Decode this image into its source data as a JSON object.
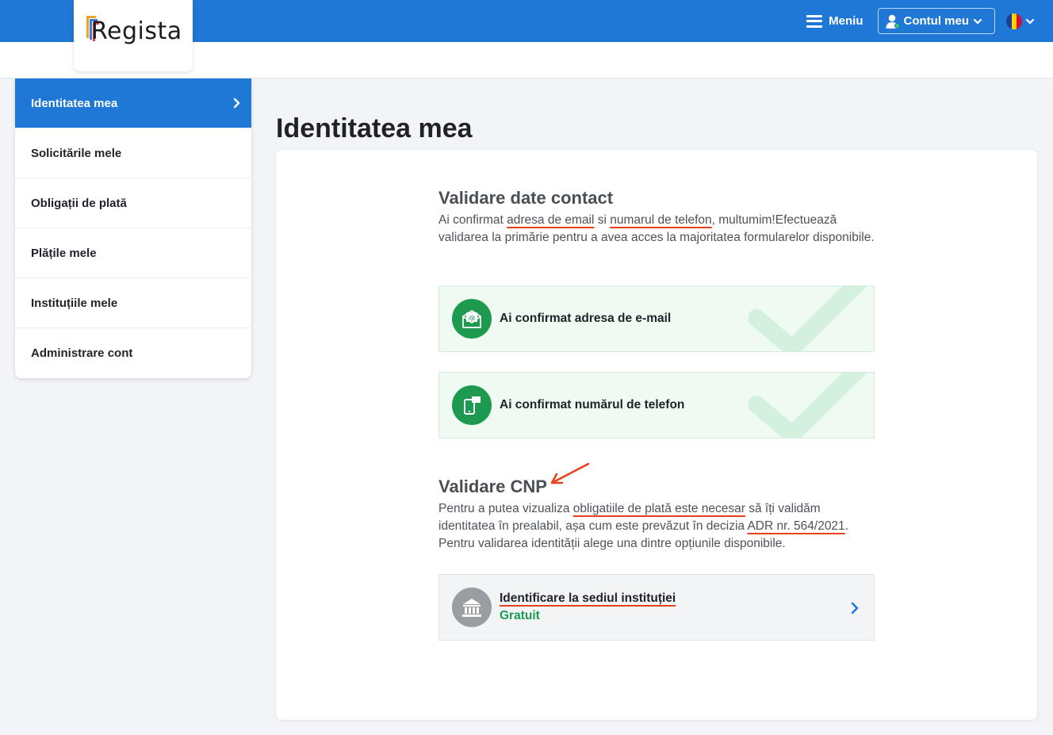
{
  "header": {
    "brand": "Regista",
    "menu_label": "Meniu",
    "account_label": "Contul meu",
    "language_flag": "Romania"
  },
  "sidebar": {
    "items": [
      {
        "label": "Identitatea mea",
        "active": true
      },
      {
        "label": "Solicitările mele",
        "active": false
      },
      {
        "label": "Obligații de plată",
        "active": false
      },
      {
        "label": "Plățile mele",
        "active": false
      },
      {
        "label": "Instituțiile mele",
        "active": false
      },
      {
        "label": "Administrare cont",
        "active": false
      }
    ]
  },
  "main": {
    "page_title": "Identitatea mea",
    "contact": {
      "heading": "Validare date contact",
      "text_1": "Ai confirmat ",
      "text_email": "adresa de email",
      "text_2": " si ",
      "text_phone": "numarul de telefon",
      "text_3": ", multumim!Efectuează validarea la primărie pentru a avea acces la majoritatea formularelor disponibile.",
      "email_status": "Ai confirmat adresa de e-mail",
      "phone_status": "Ai confirmat numărul de telefon"
    },
    "cnp": {
      "heading": "Validare CNP",
      "text_1": "Pentru a putea vizualiza ",
      "text_obligations": "obligatiile de plată este necesar",
      "text_2": " să îți validăm identitatea în prealabil, așa cum este prevăzut în decizia ",
      "text_adr": "ADR nr. 564/2021",
      "text_3": ". Pentru validarea identității alege una dintre opțiunile disponibile.",
      "option_title": "Identificare la sediul instituției",
      "option_price": "Gratuit"
    }
  },
  "colors": {
    "primary": "#1f77d6",
    "success": "#1e9a50",
    "annotation": "#e8401c"
  }
}
